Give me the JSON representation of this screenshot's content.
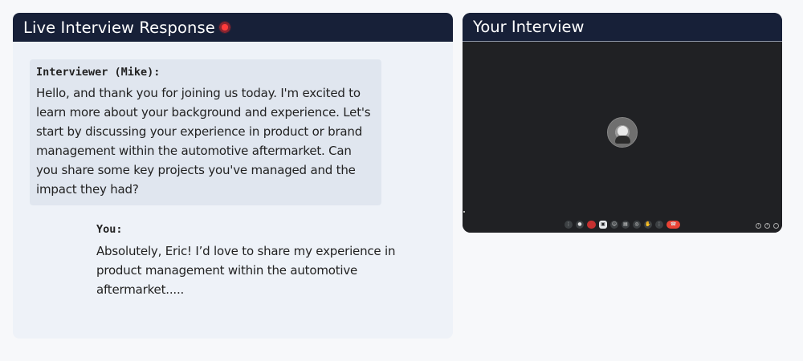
{
  "left_panel": {
    "title": "Live Interview Response",
    "interviewer_label": "Interviewer (Mike):",
    "interviewer_message": "Hello, and thank you for joining us today. I'm excited to learn more about your background and experience. Let's start by discussing your experience in product or brand management within the automotive aftermarket. Can you share some key projects you've managed and the impact they had?",
    "you_label": "You:",
    "you_message": "Absolutely, Eric! I’d love to share my experience in product management within the automotive aftermarket....."
  },
  "right_panel": {
    "title": "Your Interview",
    "controls": [
      "mic-icon",
      "camera-off-icon",
      "captions-icon",
      "emoji-icon",
      "present-icon",
      "more-icon",
      "raise-hand-icon",
      "options-icon",
      "end-call-icon"
    ],
    "side_controls": [
      "info-icon",
      "people-icon",
      "chat-icon"
    ]
  },
  "colors": {
    "header_bg": "#172038",
    "panel_bg": "#eef2f8",
    "bubble_bg": "#e0e6ef",
    "live_dot": "#e53935",
    "video_bg": "#202124",
    "end_call": "#ea4335"
  }
}
